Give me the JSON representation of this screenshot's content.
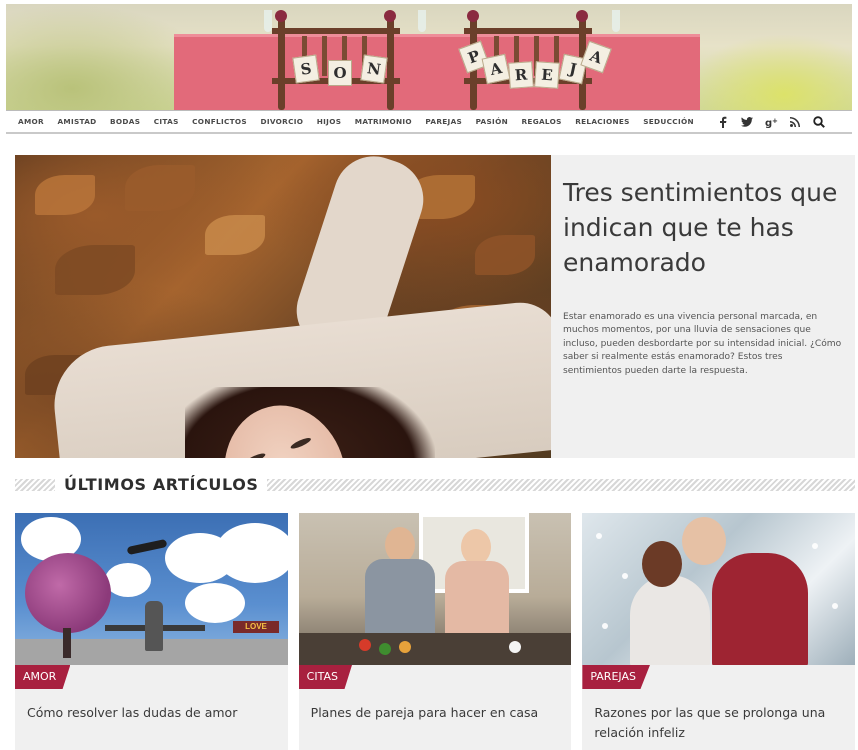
{
  "banner": {
    "letters_left": [
      "S",
      "O",
      "N"
    ],
    "letters_right": [
      "P",
      "A",
      "R",
      "E",
      "J",
      "A"
    ]
  },
  "nav": {
    "items": [
      "AMOR",
      "AMISTAD",
      "BODAS",
      "CITAS",
      "CONFLICTOS",
      "DIVORCIO",
      "HIJOS",
      "MATRIMONIO",
      "PAREJAS",
      "PASIÓN",
      "REGALOS",
      "RELACIONES",
      "SEDUCCIÓN"
    ],
    "social_icons": [
      "facebook-icon",
      "twitter-icon",
      "google-plus-icon",
      "rss-icon",
      "search-icon"
    ]
  },
  "featured": {
    "title": "Tres sentimientos que indican que te has enamorado",
    "description": "Estar enamorado es una vivencia personal marcada, en muchos momentos, por una lluvia de sensaciones que incluso, pueden desbordarte por su intensidad inicial. ¿Cómo saber si realmente estás enamorado? Estos tres sentimientos pueden darte la respuesta."
  },
  "section": {
    "title": "ÚLTIMOS ARTÍCULOS"
  },
  "cards": [
    {
      "category": "AMOR",
      "title": "Cómo resolver las dudas de amor",
      "sign_text": "LOVE"
    },
    {
      "category": "CITAS",
      "title": "Planes de pareja para hacer en casa"
    },
    {
      "category": "PAREJAS",
      "title": "Razones por las que se prolonga una relación infeliz"
    }
  ],
  "colors": {
    "accent": "#a8203f",
    "panel": "#f0f0f0",
    "tablecloth": "#e26a7a"
  }
}
